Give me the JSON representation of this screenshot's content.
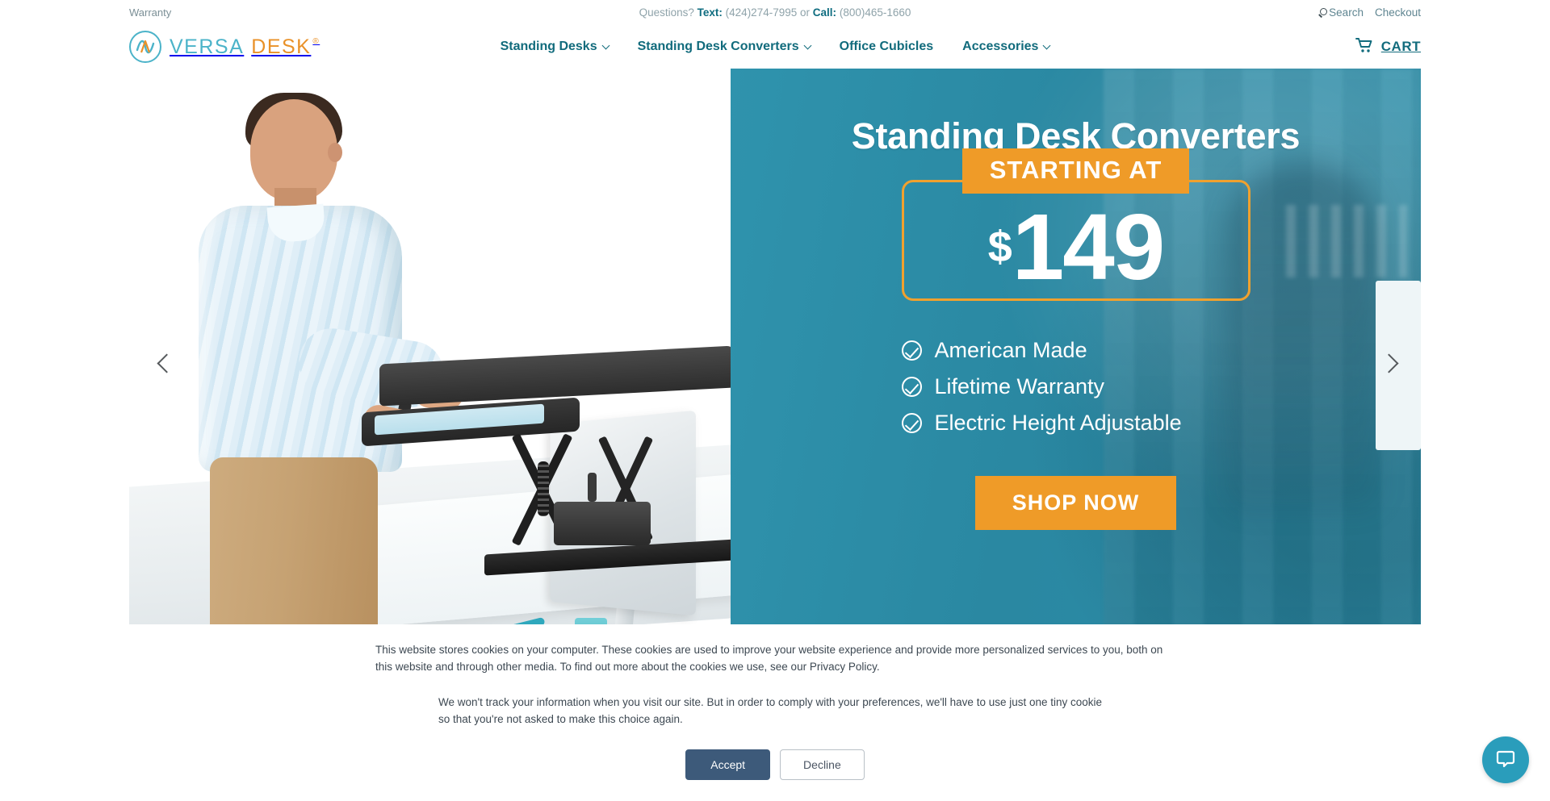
{
  "topbar": {
    "warranty_label": "Warranty",
    "questions_prefix": "Questions?",
    "text_label": "Text:",
    "text_number": "(424)274-7995",
    "or_label": "or",
    "call_label": "Call:",
    "call_number": "(800)465-1660",
    "search_label": "Search",
    "checkout_label": "Checkout"
  },
  "header": {
    "logo_versa": "VERSA",
    "logo_desk": "DESK",
    "logo_registered": "®",
    "cart_label": "CART",
    "nav": [
      {
        "label": "Standing Desks",
        "has_dropdown": true
      },
      {
        "label": "Standing Desk Converters",
        "has_dropdown": true
      },
      {
        "label": "Office Cubicles",
        "has_dropdown": false
      },
      {
        "label": "Accessories",
        "has_dropdown": true
      }
    ]
  },
  "hero": {
    "title": "Standing Desk Converters",
    "starting_at": "STARTING AT",
    "currency": "$",
    "price": "149",
    "features": [
      "American Made",
      "Lifetime Warranty",
      "Electric Height Adjustable"
    ],
    "cta_label": "SHOP NOW",
    "prev_arrow": "‹",
    "next_arrow": "›",
    "panel_color": "#2c8ca6",
    "accent_color": "#ef9b28"
  },
  "cookie": {
    "paragraph1": "This website stores cookies on your computer. These cookies are used to improve your website experience and provide more personalized services to you, both on this website and through other media. To find out more about the cookies we use, see our Privacy Policy.",
    "paragraph2": "We won't track your information when you visit our site. But in order to comply with your preferences, we'll have to use just one tiny cookie so that you're not asked to make this choice again.",
    "accept_label": "Accept",
    "decline_label": "Decline"
  },
  "chat": {
    "icon": "chat-bubble-icon",
    "color": "#2a9dbb"
  }
}
